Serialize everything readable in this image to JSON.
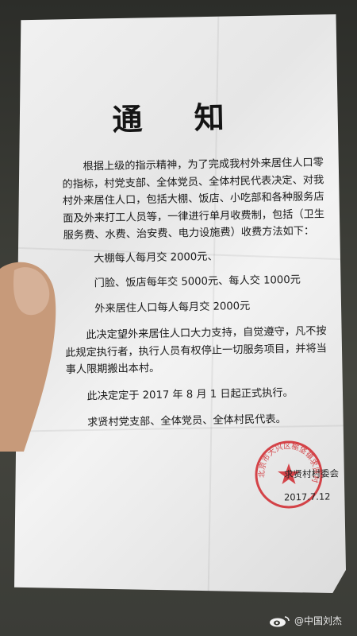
{
  "notice": {
    "title": "通 知",
    "paragraphs": [
      "根据上级的指示精神，为了完成我村外来居住人口零的指标，村党支部、全体党员、全体村民代表决定、对我村外来居住人口，包括大棚、饭店、小吃部和各种服务店面及外来打工人员等，一律进行单月收费制，包括（卫生服务费、水费、治安费、电力设施费）收费方法如下："
    ],
    "fees": [
      "大棚每人每月交 2000元、",
      "门脸、饭店每年交 5000元、每人交 1000元",
      "外来居住人口每人每月交 2000元"
    ],
    "rules": [
      "此决定望外来居住人口大力支持，自觉遵守，凡不按此规定执行者，执行人员有权停止一切服务项目，并将当事人限期搬出本村。",
      "此决定定于 2017 年 8 月 1 日起正式执行。",
      "求贤村党支部、全体党员、全体村民代表。"
    ],
    "signature": "求贤村村委会",
    "date": "2017.7.12",
    "seal_text": "北京市大兴区榆垡镇求贤村民委员会",
    "seal_color": "#d0262b"
  },
  "watermark": {
    "icon": "weibo-logo-icon",
    "text": "@中国刘杰"
  }
}
